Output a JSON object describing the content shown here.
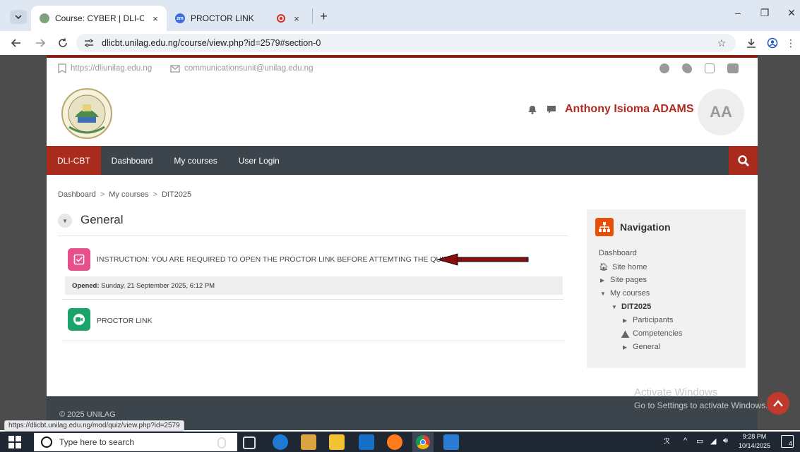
{
  "browser": {
    "tabs": [
      {
        "title": "Course: CYBER | DLI-CBT",
        "close": "×"
      },
      {
        "title": "PROCTOR LINK",
        "close": "×",
        "favicon_text": "zm"
      }
    ],
    "new_tab": "+",
    "window_controls": {
      "minimize": "–",
      "restore": "❐",
      "close": "✕"
    },
    "url": "dlicbt.unilag.edu.ng/course/view.php?id=2579#section-0",
    "status_link": "https://dlicbt.unilag.edu.ng/mod/quiz/view.php?id=2579"
  },
  "site": {
    "top_links": {
      "website": "https://dliunilag.edu.ng",
      "email": "communicationsunit@unilag.edu.ng"
    },
    "user": {
      "name": "Anthony Isioma ADAMS",
      "initials": "AA"
    },
    "navbar": [
      "DLI-CBT",
      "Dashboard",
      "My courses",
      "User Login"
    ],
    "breadcrumb": [
      "Dashboard",
      "My courses",
      "DIT2025"
    ],
    "section_title": "General",
    "activities": [
      {
        "text": "INSTRUCTION: YOU ARE REQUIRED TO OPEN THE PROCTOR LINK BEFORE ATTEMTING THE QUIZ",
        "opened_label": "Opened:",
        "opened_value": "Sunday, 21 September 2025, 6:12 PM"
      },
      {
        "text": "PROCTOR LINK"
      }
    ],
    "navigation_block": {
      "title": "Navigation",
      "items": [
        "Dashboard",
        "Site home",
        "Site pages",
        "My courses",
        "DIT2025",
        "Participants",
        "Competencies",
        "General"
      ]
    },
    "footer": "© 2025 UNILAG",
    "activate_windows": "Activate Windows",
    "activate_windows_sub": "Go to Settings to activate Windows."
  },
  "taskbar": {
    "search_placeholder": "Type here to search",
    "time": "9:28 PM",
    "date": "10/14/2025",
    "notification_count": "4"
  },
  "colors": {
    "brand_red": "#a82b1c",
    "nav_dark": "#3c444c",
    "quiz_pink": "#e54f8a",
    "zoom_green": "#1aa36b"
  }
}
